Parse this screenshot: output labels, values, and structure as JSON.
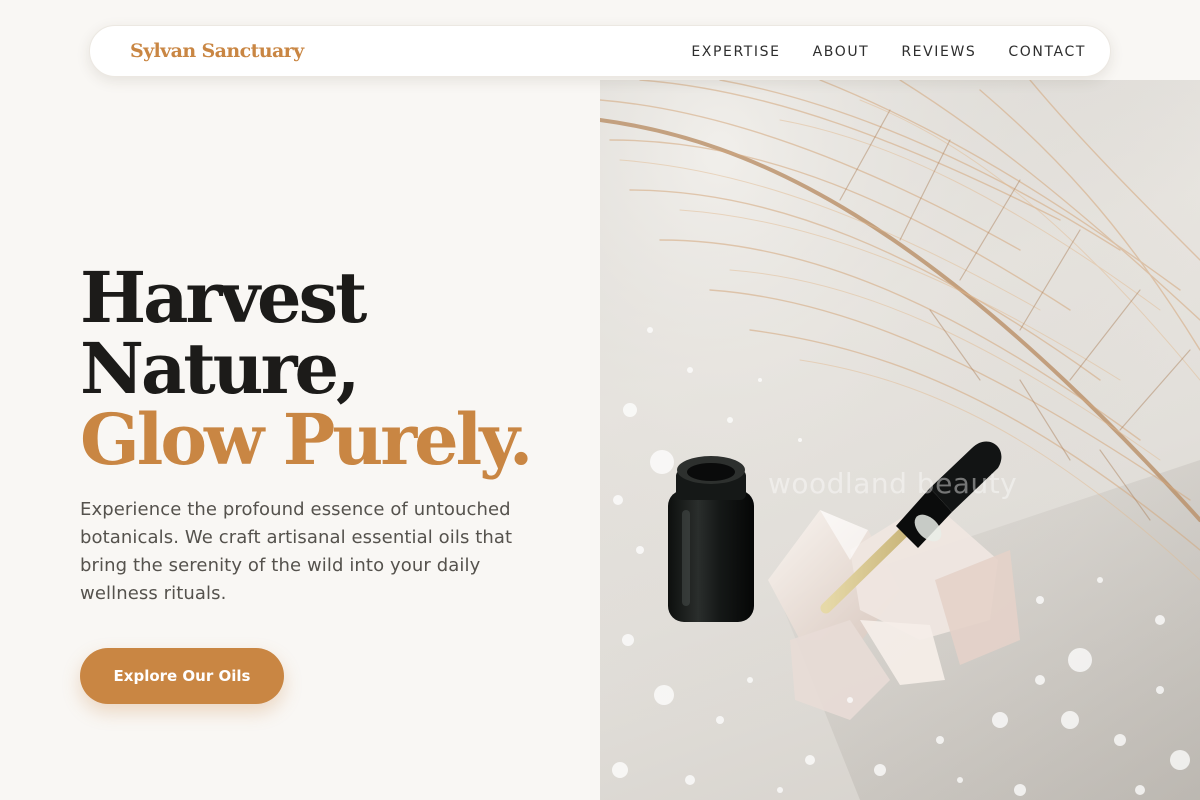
{
  "brand": {
    "name": "Sylvan Sanctuary"
  },
  "nav": {
    "items": [
      {
        "label": "EXPERTISE"
      },
      {
        "label": "ABOUT"
      },
      {
        "label": "REVIEWS"
      },
      {
        "label": "CONTACT"
      }
    ]
  },
  "hero": {
    "headline_line1": "Harvest",
    "headline_line2": "Nature,",
    "headline_accent": "Glow Purely.",
    "description": "Experience the profound essence of untouched botanicals. We craft artisanal essential oils that bring the serenity of the wild into your daily wellness rituals.",
    "cta_label": "Explore Our Oils",
    "image_watermark": "woodland beauty"
  },
  "colors": {
    "accent": "#c98643",
    "background": "#f9f7f4",
    "heading": "#1c1b19",
    "body_text": "#55524d"
  }
}
